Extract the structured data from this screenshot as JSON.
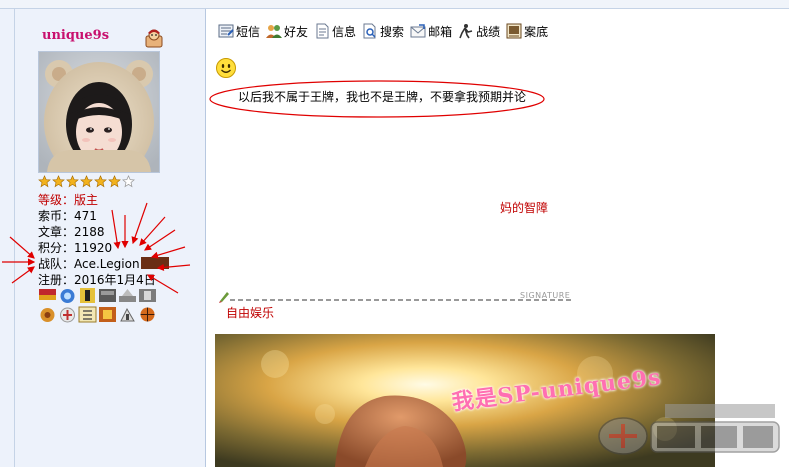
{
  "user": {
    "username": "unique9s",
    "rank": "等级：版主",
    "coins": "索币：471",
    "posts": "文章：2188",
    "points": "积分：11920",
    "team": "战队：Ace.Legion",
    "registered": "注册：2016年1月4日",
    "star_count": 7,
    "stars_filled": 6
  },
  "toolbar": {
    "items": [
      {
        "label": "短信",
        "icon": "message-icon"
      },
      {
        "label": "好友",
        "icon": "friends-icon"
      },
      {
        "label": "信息",
        "icon": "info-icon"
      },
      {
        "label": "搜索",
        "icon": "search-icon"
      },
      {
        "label": "邮箱",
        "icon": "mail-icon"
      },
      {
        "label": "战绩",
        "icon": "stats-icon"
      },
      {
        "label": "案底",
        "icon": "record-icon"
      }
    ]
  },
  "post": {
    "text": "以后我不属于王牌，我也不是王牌，不要拿我预期并论",
    "middle_text": "妈的智障"
  },
  "signature": {
    "label": "SIGNATURE",
    "text": "自由娱乐",
    "image_text": "我是SP-unique9s"
  },
  "colors": {
    "username": "#c8106e",
    "rank": "#c00000",
    "annotation_red": "#e00000",
    "panel_bg": "#edf2fb"
  }
}
